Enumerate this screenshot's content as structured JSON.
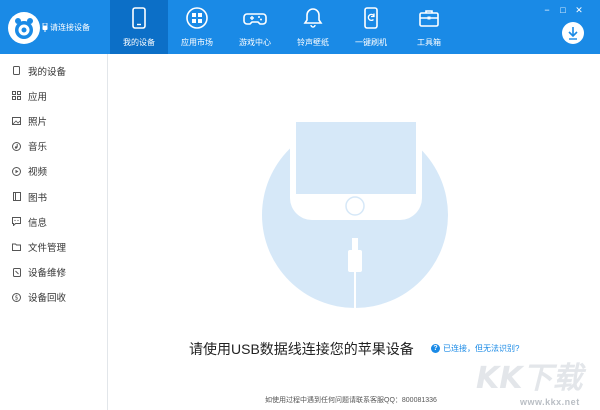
{
  "app": {
    "connection_status": "请连接设备",
    "colors": {
      "primary": "#1a8ae6",
      "primary_dark": "#0c6fc7",
      "sidebar_text": "#333333",
      "illustration": "#d6e8f8"
    }
  },
  "nav": {
    "tabs": [
      {
        "label": "我的设备",
        "icon": "phone-icon",
        "active": true
      },
      {
        "label": "应用市场",
        "icon": "apps-icon",
        "active": false
      },
      {
        "label": "游戏中心",
        "icon": "gamepad-icon",
        "active": false
      },
      {
        "label": "铃声壁纸",
        "icon": "bell-icon",
        "active": false
      },
      {
        "label": "一键刷机",
        "icon": "flash-icon",
        "active": false
      },
      {
        "label": "工具箱",
        "icon": "toolbox-icon",
        "active": false
      }
    ]
  },
  "window_controls": {
    "minimize": "−",
    "maximize": "□",
    "close": "✕"
  },
  "sidebar": {
    "items": [
      {
        "label": "我的设备",
        "icon": "device-icon"
      },
      {
        "label": "应用",
        "icon": "grid-icon"
      },
      {
        "label": "照片",
        "icon": "photo-icon"
      },
      {
        "label": "音乐",
        "icon": "music-icon"
      },
      {
        "label": "视频",
        "icon": "video-icon"
      },
      {
        "label": "图书",
        "icon": "book-icon"
      },
      {
        "label": "信息",
        "icon": "message-icon"
      },
      {
        "label": "文件管理",
        "icon": "folder-icon"
      },
      {
        "label": "设备维修",
        "icon": "repair-icon"
      },
      {
        "label": "设备回收",
        "icon": "recycle-icon"
      }
    ]
  },
  "main": {
    "connect_message": "请使用USB数据线连接您的苹果设备",
    "help_link": "已连接，但无法识别?",
    "footer_note": "如使用过程中遇到任何问题请联系客服QQ：800081336"
  },
  "watermark": {
    "text": "www.kkx.net",
    "logo_text": "KK下载"
  }
}
